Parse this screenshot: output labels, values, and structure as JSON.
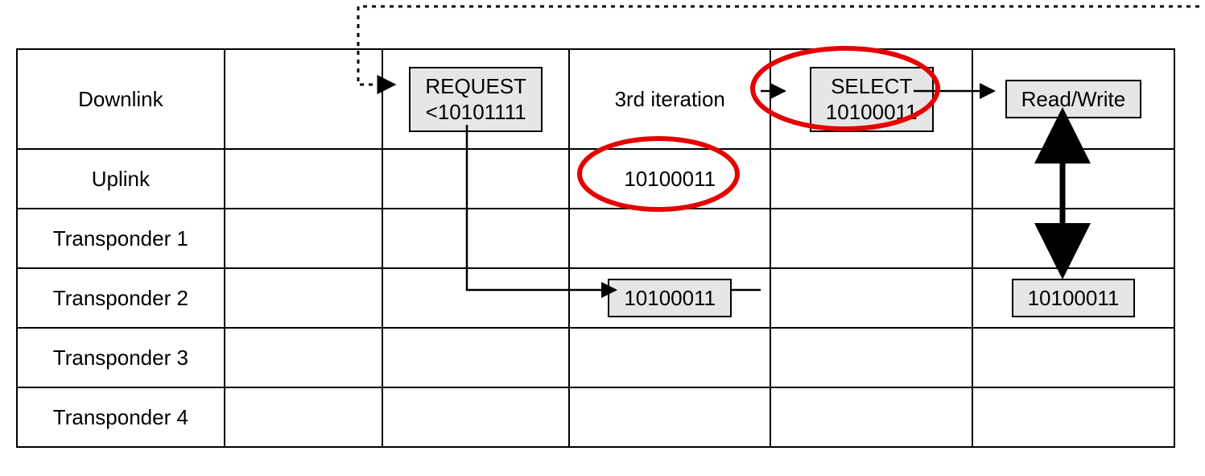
{
  "rows": {
    "downlink": "Downlink",
    "uplink": "Uplink",
    "t1": "Transponder 1",
    "t2": "Transponder 2",
    "t3": "Transponder 3",
    "t4": "Transponder 4"
  },
  "downlink": {
    "request_label": "REQUEST",
    "request_value": "<10101111",
    "iteration_label": "3rd iteration",
    "select_label": "SELECT",
    "select_value": "10100011",
    "readwrite_label": "Read/Write"
  },
  "uplink_value": "10100011",
  "transponder2_coll_value": "10100011",
  "transponder2_rw_value": "10100011",
  "colors": {
    "highlight": "#e60000",
    "box_fill": "#e6e6e6"
  }
}
